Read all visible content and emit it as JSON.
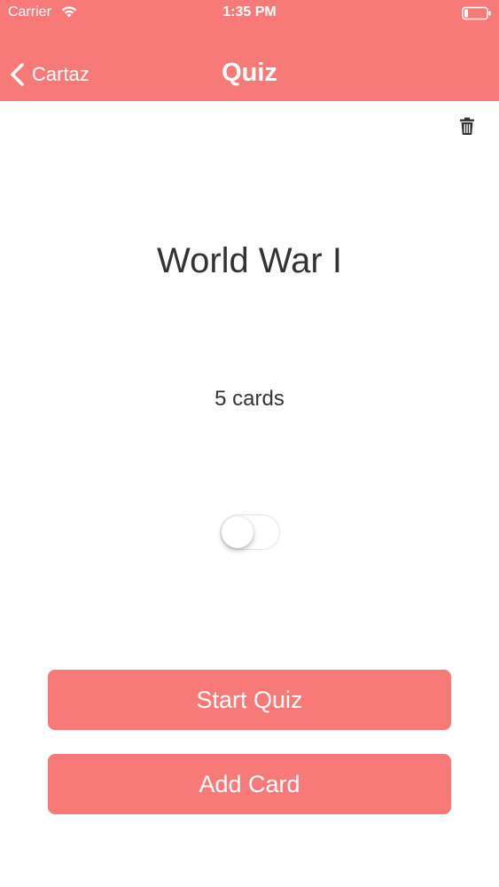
{
  "status_bar": {
    "carrier": "Carrier",
    "time": "1:35 PM",
    "icons": [
      "wifi-icon",
      "battery-icon"
    ]
  },
  "nav": {
    "back_label": "Cartaz",
    "title": "Quiz",
    "back_icon": "chevron-left-icon"
  },
  "deck": {
    "title": "World War I",
    "card_count": "5 cards",
    "toggle_on": false
  },
  "actions": {
    "start_quiz": "Start Quiz",
    "add_card": "Add Card",
    "delete_icon": "trash-icon"
  },
  "colors": {
    "accent": "#f77a79",
    "text": "#333333",
    "background": "#ffffff"
  }
}
